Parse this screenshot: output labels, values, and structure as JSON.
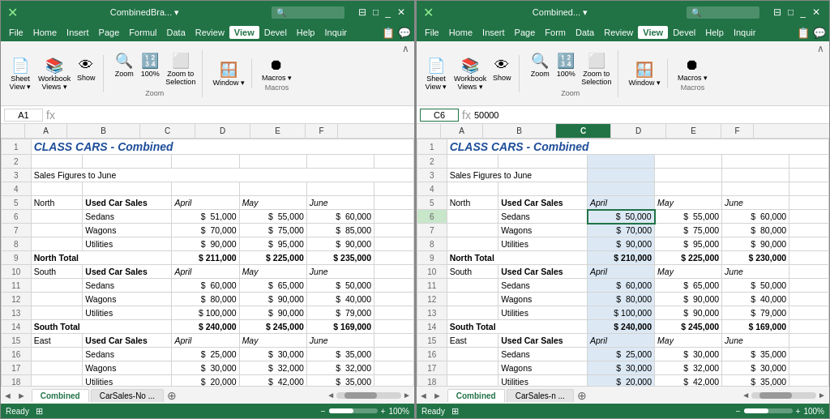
{
  "windows": [
    {
      "id": "left",
      "titlebar": {
        "icon": "⊞",
        "title": "CombinedBra... ▾",
        "search_placeholder": "🔍",
        "controls": [
          "□",
          "_",
          "✕"
        ]
      },
      "menubar": {
        "items": [
          "File",
          "Home",
          "Insert",
          "Page",
          "Formul",
          "Data",
          "Review",
          "View",
          "Devel",
          "Help",
          "Inquir"
        ],
        "active": "View",
        "share_icons": [
          "📋",
          "💬"
        ]
      },
      "ribbon": {
        "groups": [
          {
            "label": "",
            "buttons": [
              {
                "icon": "📄",
                "label": "Sheet\nView ▾"
              },
              {
                "icon": "📚",
                "label": "Workbook\nViews ▾"
              },
              {
                "icon": "👁",
                "label": "Show"
              }
            ]
          },
          {
            "label": "Zoom",
            "buttons": [
              {
                "icon": "🔍",
                "label": "Zoom"
              },
              {
                "icon": "🔢",
                "label": "100%"
              },
              {
                "icon": "🔲",
                "label": "Zoom to\nSelection"
              }
            ]
          },
          {
            "label": "",
            "buttons": [
              {
                "icon": "🪟",
                "label": "Window\n▾"
              }
            ]
          },
          {
            "label": "Macros",
            "buttons": [
              {
                "icon": "⏺",
                "label": "Macros\n▾"
              }
            ]
          }
        ]
      },
      "namebox": "A1",
      "formula": "",
      "selected_col": "",
      "spreadsheet": {
        "title_row": "CLASS CARS - Combined",
        "rows": [
          {
            "row": 1,
            "a": "",
            "b": "",
            "c": "",
            "d": "",
            "e": "",
            "f": ""
          },
          {
            "row": 2,
            "a": "",
            "b": "",
            "c": "",
            "d": "",
            "e": "",
            "f": ""
          },
          {
            "row": 3,
            "a": "Sales Figures to June",
            "b": "",
            "c": "",
            "d": "",
            "e": "",
            "f": ""
          },
          {
            "row": 4,
            "a": "",
            "b": "",
            "c": "",
            "d": "",
            "e": "",
            "f": ""
          },
          {
            "row": 5,
            "a": "North",
            "b": "Used Car Sales",
            "c": "April",
            "d": "May",
            "e": "June",
            "f": ""
          },
          {
            "row": 6,
            "a": "",
            "b": "Sedans",
            "c": "$",
            "c2": "51,000",
            "d": "$",
            "d2": "55,000",
            "e": "$",
            "e2": "60,000",
            "f": ""
          },
          {
            "row": 7,
            "a": "",
            "b": "Wagons",
            "c": "$",
            "c2": "70,000",
            "d": "$",
            "d2": "75,000",
            "e": "$",
            "e2": "85,000",
            "f": ""
          },
          {
            "row": 8,
            "a": "",
            "b": "Utilities",
            "c": "$",
            "c2": "90,000",
            "d": "$",
            "d2": "95,000",
            "e": "$",
            "e2": "90,000",
            "f": ""
          },
          {
            "row": 9,
            "a": "North Total",
            "b": "",
            "c": "$",
            "c2": "211,000",
            "d": "$",
            "d2": "225,000",
            "e": "$",
            "e2": "235,000",
            "f": ""
          },
          {
            "row": 10,
            "a": "South",
            "b": "Used Car Sales",
            "c": "April",
            "d": "May",
            "e": "June",
            "f": ""
          },
          {
            "row": 11,
            "a": "",
            "b": "Sedans",
            "c": "$",
            "c2": "60,000",
            "d": "$",
            "d2": "65,000",
            "e": "$",
            "e2": "50,000",
            "f": ""
          },
          {
            "row": 12,
            "a": "",
            "b": "Wagons",
            "c": "$",
            "c2": "80,000",
            "d": "$",
            "d2": "90,000",
            "e": "$",
            "e2": "40,000",
            "f": ""
          },
          {
            "row": 13,
            "a": "",
            "b": "Utilities",
            "c": "$",
            "c2": "100,000",
            "d": "$",
            "d2": "90,000",
            "e": "$",
            "e2": "79,000",
            "f": ""
          },
          {
            "row": 14,
            "a": "South Total",
            "b": "",
            "c": "$",
            "c2": "240,000",
            "d": "$",
            "d2": "245,000",
            "e": "$",
            "e2": "169,000",
            "f": ""
          },
          {
            "row": 15,
            "a": "East",
            "b": "Used Car Sales",
            "c": "April",
            "d": "May",
            "e": "June",
            "f": ""
          },
          {
            "row": 16,
            "a": "",
            "b": "Sedans",
            "c": "$",
            "c2": "25,000",
            "d": "$",
            "d2": "30,000",
            "e": "$",
            "e2": "35,000",
            "f": ""
          },
          {
            "row": 17,
            "a": "",
            "b": "Wagons",
            "c": "$",
            "c2": "30,000",
            "d": "$",
            "d2": "32,000",
            "e": "$",
            "e2": "32,000",
            "f": ""
          },
          {
            "row": 18,
            "a": "",
            "b": "Utilities",
            "c": "$",
            "c2": "20,000",
            "d": "$",
            "d2": "42,000",
            "e": "$",
            "e2": "35,000",
            "f": ""
          }
        ]
      },
      "tabs": [
        {
          "label": "Combined",
          "active": true
        },
        {
          "label": "CarSales-No ...",
          "active": false
        }
      ],
      "status": {
        "ready": "Ready",
        "zoom": "100%"
      }
    },
    {
      "id": "right",
      "titlebar": {
        "icon": "⊞",
        "title": "Combined... ▾",
        "search_placeholder": "🔍",
        "controls": [
          "□",
          "_",
          "✕"
        ]
      },
      "menubar": {
        "items": [
          "File",
          "Home",
          "Insert",
          "Page",
          "Form",
          "Data",
          "Review",
          "View",
          "Devel",
          "Help",
          "Inquir"
        ],
        "active": "View",
        "share_icons": [
          "📋",
          "💬"
        ]
      },
      "selected_col": "C",
      "spreadsheet": {
        "title_row": "CLASS CARS - Combined",
        "rows": [
          {
            "row": 1,
            "a": "",
            "b": "",
            "c": "",
            "d": "",
            "e": "",
            "f": ""
          },
          {
            "row": 2,
            "a": "",
            "b": "",
            "c": "",
            "d": "",
            "e": "",
            "f": ""
          },
          {
            "row": 3,
            "a": "Sales Figures to June",
            "b": "",
            "c": "",
            "d": "",
            "e": "",
            "f": ""
          },
          {
            "row": 4,
            "a": "",
            "b": "",
            "c": "",
            "d": "",
            "e": "",
            "f": ""
          },
          {
            "row": 5,
            "a": "North",
            "b": "Used Car Sales",
            "c": "April",
            "d": "May",
            "e": "June",
            "f": ""
          },
          {
            "row": 6,
            "a": "",
            "b": "Sedans",
            "c": "$",
            "c2": "50,000",
            "d": "$",
            "d2": "55,000",
            "e": "$",
            "e2": "60,000",
            "f": "",
            "c_selected": true
          },
          {
            "row": 7,
            "a": "",
            "b": "Wagons",
            "c": "$",
            "c2": "70,000",
            "d": "$",
            "d2": "75,000",
            "e": "$",
            "e2": "80,000",
            "f": ""
          },
          {
            "row": 8,
            "a": "",
            "b": "Utilities",
            "c": "$",
            "c2": "90,000",
            "d": "$",
            "d2": "95,000",
            "e": "$",
            "e2": "90,000",
            "f": ""
          },
          {
            "row": 9,
            "a": "North Total",
            "b": "",
            "c": "$",
            "c2": "210,000",
            "d": "$",
            "d2": "225,000",
            "e": "$",
            "e2": "230,000",
            "f": ""
          },
          {
            "row": 10,
            "a": "South",
            "b": "Used Car Sales",
            "c": "April",
            "d": "May",
            "e": "June",
            "f": ""
          },
          {
            "row": 11,
            "a": "",
            "b": "Sedans",
            "c": "$",
            "c2": "60,000",
            "d": "$",
            "d2": "65,000",
            "e": "$",
            "e2": "50,000",
            "f": ""
          },
          {
            "row": 12,
            "a": "",
            "b": "Wagons",
            "c": "$",
            "c2": "80,000",
            "d": "$",
            "d2": "90,000",
            "e": "$",
            "e2": "40,000",
            "f": ""
          },
          {
            "row": 13,
            "a": "",
            "b": "Utilities",
            "c": "$",
            "c2": "100,000",
            "d": "$",
            "d2": "90,000",
            "e": "$",
            "e2": "79,000",
            "f": ""
          },
          {
            "row": 14,
            "a": "South Total",
            "b": "",
            "c": "$",
            "c2": "240,000",
            "d": "$",
            "d2": "245,000",
            "e": "$",
            "e2": "169,000",
            "f": ""
          },
          {
            "row": 15,
            "a": "East",
            "b": "Used Car Sales",
            "c": "April",
            "d": "May",
            "e": "June",
            "f": ""
          },
          {
            "row": 16,
            "a": "",
            "b": "Sedans",
            "c": "$",
            "c2": "25,000",
            "d": "$",
            "d2": "30,000",
            "e": "$",
            "e2": "35,000",
            "f": ""
          },
          {
            "row": 17,
            "a": "",
            "b": "Wagons",
            "c": "$",
            "c2": "30,000",
            "d": "$",
            "d2": "32,000",
            "e": "$",
            "e2": "30,000",
            "f": ""
          },
          {
            "row": 18,
            "a": "",
            "b": "Utilities",
            "c": "$",
            "c2": "20,000",
            "d": "$",
            "d2": "42,000",
            "e": "$",
            "e2": "35,000",
            "f": ""
          }
        ]
      },
      "tabs": [
        {
          "label": "Combined",
          "active": true
        },
        {
          "label": "CarSales-n ...",
          "active": false
        }
      ],
      "status": {
        "ready": "Ready",
        "zoom": "100%"
      }
    }
  ],
  "colors": {
    "excel_green": "#217346",
    "title_blue": "#1F4E9A",
    "selected_cell": "#dce9f5",
    "selected_col_header": "#217346"
  }
}
